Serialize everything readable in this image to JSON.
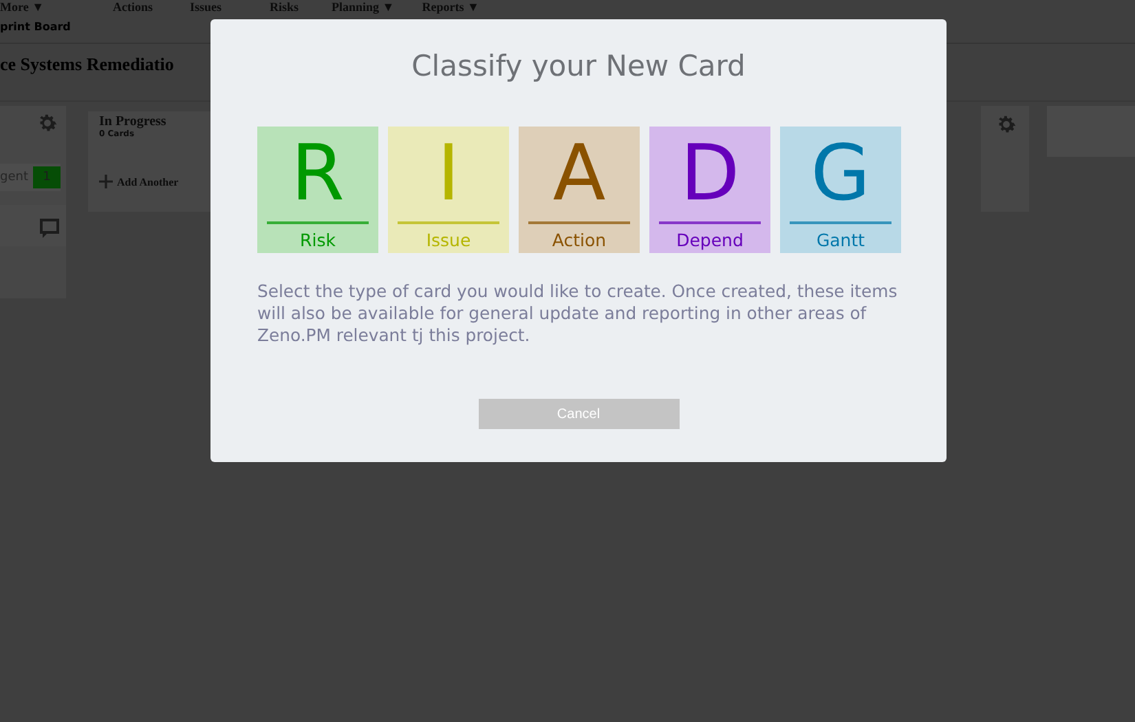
{
  "nav": {
    "items": [
      "More ▼",
      "Actions",
      "Issues",
      "Risks",
      "Planning ▼",
      "Reports ▼"
    ],
    "sub_item": "print Board"
  },
  "project_title": "ce Systems Remediatio",
  "board": {
    "first_column": {
      "tag": "gent",
      "tag_count": "1"
    },
    "second_column": {
      "title": "In Progress",
      "count": "0 Cards",
      "add_label": "Add Another"
    }
  },
  "dialog": {
    "title": "Classify your New Card",
    "card_types": [
      {
        "letter": "R",
        "label": "Risk",
        "color": "#009900"
      },
      {
        "letter": "I",
        "label": "Issue",
        "color": "#b5b500"
      },
      {
        "letter": "A",
        "label": "Action",
        "color": "#8a5200"
      },
      {
        "letter": "D",
        "label": "Depend",
        "color": "#6600bb"
      },
      {
        "letter": "G",
        "label": "Gantt",
        "color": "#0077aa"
      }
    ],
    "description": "Select the type of card you would like to create. Once created, these items will also be available for general update and reporting in other areas of Zeno.PM relevant tj this project.",
    "cancel_button": "Cancel"
  }
}
